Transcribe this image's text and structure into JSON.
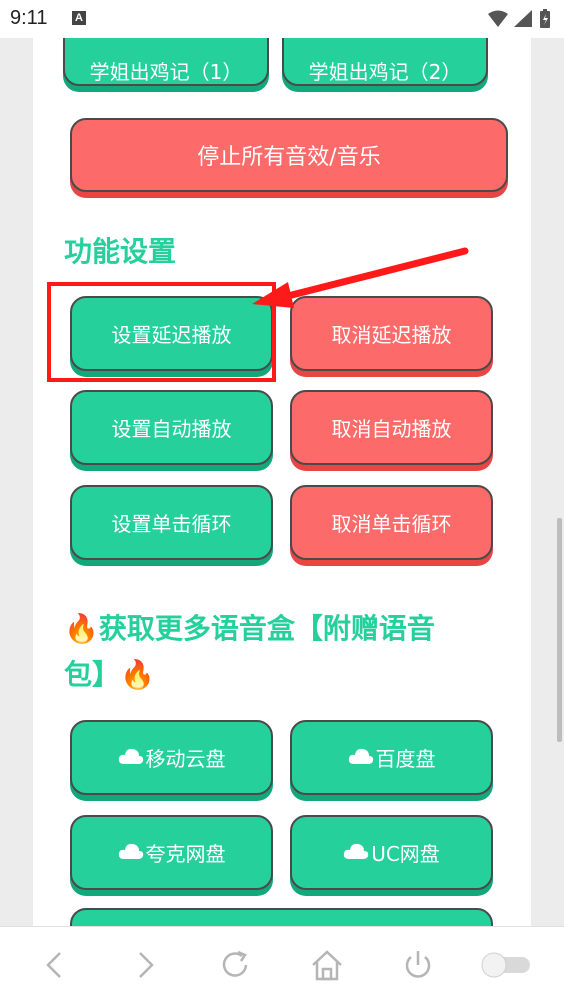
{
  "status": {
    "time": "9:11",
    "notif_letter": "A"
  },
  "top_buttons": {
    "left": "学姐出鸡记（1）",
    "right": "学姐出鸡记（2）"
  },
  "stop_button": "停止所有音效/音乐",
  "settings": {
    "title": "功能设置",
    "buttons": [
      {
        "label": "设置延迟播放",
        "style": "green"
      },
      {
        "label": "取消延迟播放",
        "style": "red"
      },
      {
        "label": "设置自动播放",
        "style": "green"
      },
      {
        "label": "取消自动播放",
        "style": "red"
      },
      {
        "label": "设置单击循环",
        "style": "green"
      },
      {
        "label": "取消单击循环",
        "style": "red"
      }
    ]
  },
  "more": {
    "title_line1": "🔥获取更多语音盒【附赠语音",
    "title_line2": "包】🔥",
    "links": [
      {
        "label": "移动云盘",
        "icon": "cloud-icon"
      },
      {
        "label": "百度盘",
        "icon": "cloud-icon"
      },
      {
        "label": "夸克网盘",
        "icon": "cloud-icon"
      },
      {
        "label": "UC网盘",
        "icon": "cloud-icon"
      }
    ]
  },
  "colors": {
    "green": "#25d09a",
    "red": "#fc6a6a",
    "highlight": "#ff1a1a"
  },
  "bottom_nav": [
    "back-icon",
    "forward-icon",
    "refresh-icon",
    "home-icon",
    "power-icon",
    "toggle-switch"
  ]
}
